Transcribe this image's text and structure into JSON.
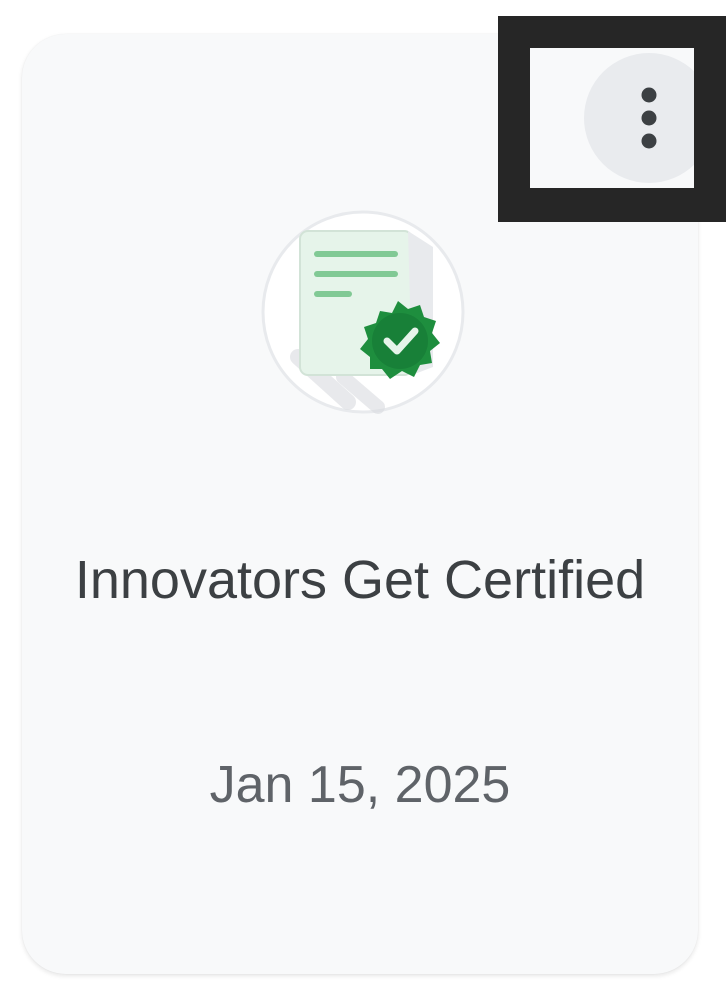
{
  "card": {
    "title": "Innovators Get Certified",
    "date": "Jan 15, 2025",
    "icon": "certificate-badge-icon",
    "menu_icon": "more-vert-icon"
  },
  "colors": {
    "card_background": "#f8f9fa",
    "menu_button_background": "#e9ebee",
    "highlight_frame": "#262626",
    "badge_green": "#1e8e3e",
    "document_green": "#e6f4ea",
    "title_text": "#3c4043",
    "date_text": "#5f6368"
  }
}
